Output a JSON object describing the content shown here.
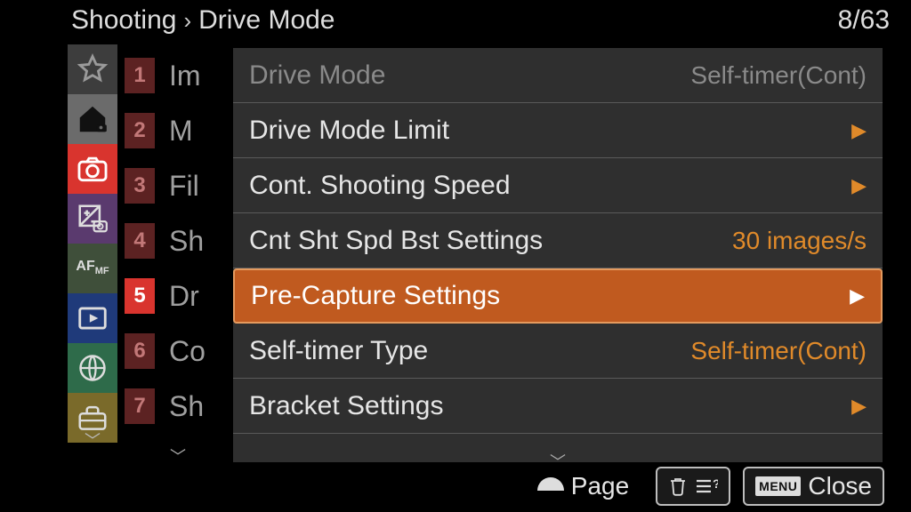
{
  "breadcrumb": {
    "section": "Shooting",
    "page": "Drive Mode"
  },
  "page_counter": "8/63",
  "sideicons": [
    {
      "name": "favorite",
      "active": false
    },
    {
      "name": "home",
      "active": true
    },
    {
      "name": "camera",
      "active": false,
      "highlight": true
    },
    {
      "name": "exposure",
      "active": false
    },
    {
      "name": "afmf",
      "active": false
    },
    {
      "name": "playback",
      "active": false
    },
    {
      "name": "network",
      "active": false
    },
    {
      "name": "setup",
      "active": false
    }
  ],
  "tabs": [
    {
      "num": "1",
      "text": "Im",
      "active": false
    },
    {
      "num": "2",
      "text": "M",
      "active": false
    },
    {
      "num": "3",
      "text": "Fil",
      "active": false
    },
    {
      "num": "4",
      "text": "Sh",
      "active": false
    },
    {
      "num": "5",
      "text": "Dr",
      "active": true
    },
    {
      "num": "6",
      "text": "Co",
      "active": false
    },
    {
      "num": "7",
      "text": "Sh",
      "active": false
    }
  ],
  "panel": {
    "items": [
      {
        "label": "Drive Mode",
        "value": "Self-timer(Cont)",
        "arrow": false,
        "disabled": true,
        "selected": false
      },
      {
        "label": "Drive Mode Limit",
        "value": "",
        "arrow": true,
        "disabled": false,
        "selected": false
      },
      {
        "label": "Cont. Shooting Speed",
        "value": "",
        "arrow": true,
        "disabled": false,
        "selected": false
      },
      {
        "label": "Cnt Sht Spd Bst Settings",
        "value": "30 images/s",
        "arrow": false,
        "disabled": false,
        "selected": false
      },
      {
        "label": "Pre-Capture Settings",
        "value": "",
        "arrow": true,
        "disabled": false,
        "selected": true
      },
      {
        "label": "Self-timer Type",
        "value": "Self-timer(Cont)",
        "arrow": false,
        "disabled": false,
        "selected": false
      },
      {
        "label": "Bracket Settings",
        "value": "",
        "arrow": true,
        "disabled": false,
        "selected": false
      }
    ]
  },
  "bottom": {
    "page_label": "Page",
    "help_label": "",
    "close_label": "Close"
  },
  "colors": {
    "accent": "#e08a2a",
    "select_bg": "#c05a1f",
    "active_red": "#d9342e"
  }
}
